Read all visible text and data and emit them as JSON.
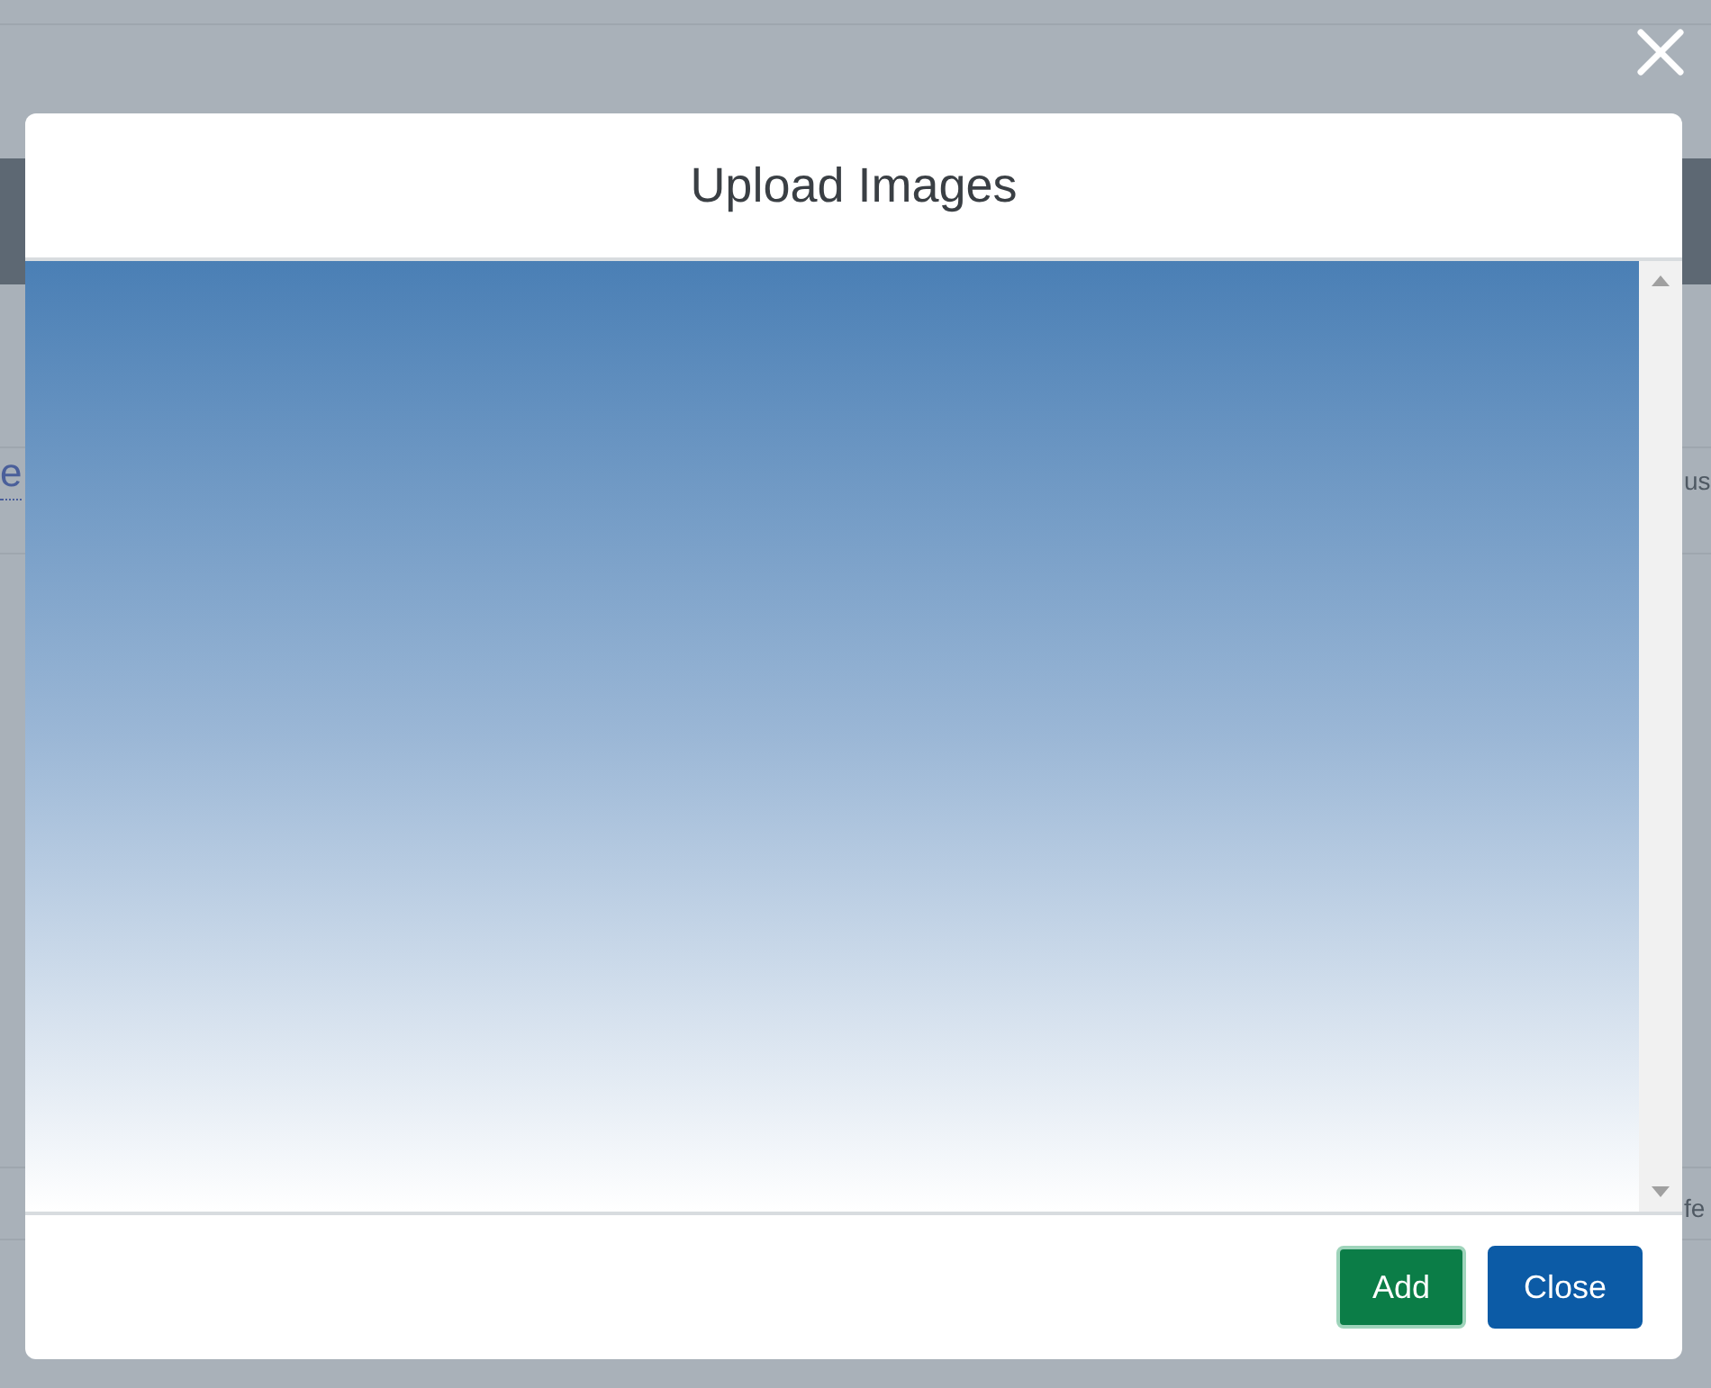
{
  "background": {
    "left_link": "e",
    "right_texts": [
      {
        "text": "us"
      },
      {
        "text": "fe"
      }
    ]
  },
  "dialog": {
    "title": "Upload Images",
    "buttons": [
      {
        "label": "Add",
        "kind": "primary"
      },
      {
        "label": "Close",
        "kind": "secondary"
      }
    ]
  }
}
